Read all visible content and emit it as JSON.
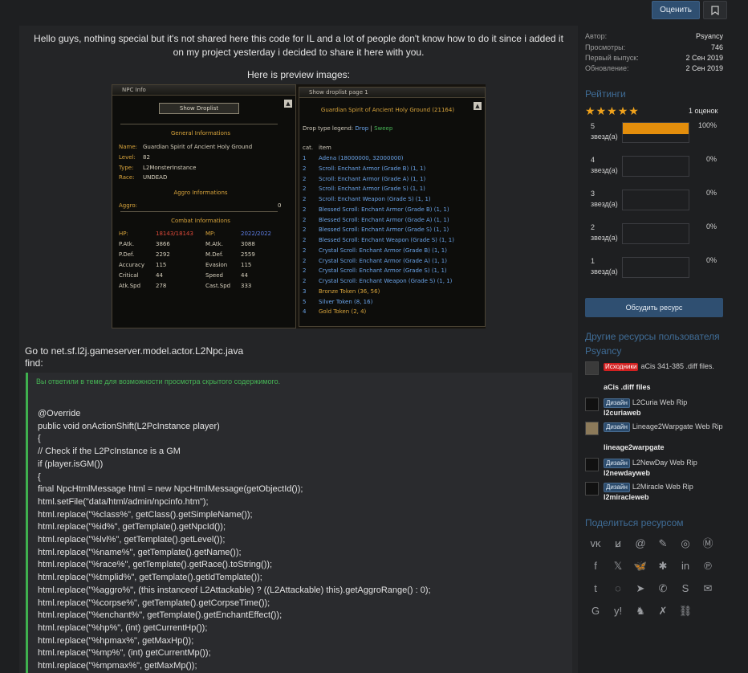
{
  "header": {
    "rate_label": "Оценить",
    "bookmark_icon": "bookmark-icon"
  },
  "post": {
    "intro": "Hello guys, nothing special but it's not shared here this code for IL and a lot of people don't know how to do it since i added it on my project yesterday i decided to share it here with you.",
    "preview_label": "Here is preview images:",
    "goto_line1": "Go to net.sf.l2j.gameserver.model.actor.L2Npc.java",
    "goto_line2": "find:",
    "hidden_message": "Вы ответили в теме для возможности просмотра скрытого содержимого.",
    "code": "@Override\npublic void onActionShift(L2PcInstance player)\n{\n// Check if the L2PcInstance is a GM\nif (player.isGM())\n{\nfinal NpcHtmlMessage html = new NpcHtmlMessage(getObjectId());\nhtml.setFile(\"data/html/admin/npcinfo.htm\");\nhtml.replace(\"%class%\", getClass().getSimpleName());\nhtml.replace(\"%id%\", getTemplate().getNpcId());\nhtml.replace(\"%lvl%\", getTemplate().getLevel());\nhtml.replace(\"%name%\", getTemplate().getName());\nhtml.replace(\"%race%\", getTemplate().getRace().toString());\nhtml.replace(\"%tmplid%\", getTemplate().getIdTemplate());\nhtml.replace(\"%aggro%\", (this instanceof L2Attackable) ? ((L2Attackable) this).getAggroRange() : 0);\nhtml.replace(\"%corpse%\", getTemplate().getCorpseTime());\nhtml.replace(\"%enchant%\", getTemplate().getEnchantEffect());\nhtml.replace(\"%hp%\", (int) getCurrentHp());\nhtml.replace(\"%hpmax%\", getMaxHp());\nhtml.replace(\"%mp%\", (int) getCurrentMp());\nhtml.replace(\"%mpmax%\", getMaxMp());"
  },
  "npc_info": {
    "title": "NPC Info",
    "show_droplist": "Show Droplist",
    "general_header": "General Informations",
    "name_label": "Name:",
    "name_value": "Guardian Spirit of Ancient Holy Ground",
    "level_label": "Level:",
    "level_value": "82",
    "type_label": "Type:",
    "type_value": "L2MonsterInstance",
    "race_label": "Race:",
    "race_value": "UNDEAD",
    "aggro_header": "Aggro Informations",
    "aggro_label": "Aggro:",
    "aggro_value": "0",
    "combat_header": "Combat Informations",
    "hp_label": "HP:",
    "hp_value": "18143/18143",
    "mp_label": "MP:",
    "mp_value": "2022/2022",
    "patk_label": "P.Atk.",
    "patk_value": "3866",
    "matk_label": "M.Atk.",
    "matk_value": "3088",
    "pdef_label": "P.Def.",
    "pdef_value": "2292",
    "mdef_label": "M.Def.",
    "mdef_value": "2559",
    "acc_label": "Accuracy",
    "acc_value": "115",
    "eva_label": "Evasion",
    "eva_value": "115",
    "crit_label": "Critical",
    "crit_value": "44",
    "spd_label": "Speed",
    "spd_value": "44",
    "aspd_label": "Atk.Spd",
    "aspd_value": "278",
    "cspd_label": "Cast.Spd",
    "cspd_value": "333"
  },
  "droplist": {
    "title": "Show droplist page 1",
    "mob": "Guardian Spirit of Ancient Holy Ground (21164)",
    "legend_label": "Drop type legend:",
    "legend_drop": "Drop",
    "legend_sweep": "Sweep",
    "col_cat": "cat.",
    "col_item": "item",
    "rows": [
      {
        "cat": "1",
        "item": "Adena (18000000, 32000000)"
      },
      {
        "cat": "2",
        "item": "Scroll: Enchant Armor (Grade B) (1, 1)"
      },
      {
        "cat": "2",
        "item": "Scroll: Enchant Armor (Grade A) (1, 1)"
      },
      {
        "cat": "2",
        "item": "Scroll: Enchant Armor (Grade S) (1, 1)"
      },
      {
        "cat": "2",
        "item": "Scroll: Enchant Weapon (Grade S) (1, 1)"
      },
      {
        "cat": "2",
        "item": "Blessed Scroll: Enchant Armor (Grade B) (1, 1)"
      },
      {
        "cat": "2",
        "item": "Blessed Scroll: Enchant Armor (Grade A) (1, 1)"
      },
      {
        "cat": "2",
        "item": "Blessed Scroll: Enchant Armor (Grade S) (1, 1)"
      },
      {
        "cat": "2",
        "item": "Blessed Scroll: Enchant Weapon (Grade S) (1, 1)"
      },
      {
        "cat": "2",
        "item": "Crystal Scroll: Enchant Armor (Grade B) (1, 1)"
      },
      {
        "cat": "2",
        "item": "Crystal Scroll: Enchant Armor (Grade A) (1, 1)"
      },
      {
        "cat": "2",
        "item": "Crystal Scroll: Enchant Armor (Grade S) (1, 1)"
      },
      {
        "cat": "2",
        "item": "Crystal Scroll: Enchant Weapon (Grade S) (1, 1)"
      },
      {
        "cat": "3",
        "item": "Bronze Token (36, 56)"
      },
      {
        "cat": "5",
        "item": "Silver Token (8, 16)"
      },
      {
        "cat": "4",
        "item": "Gold Token (2, 4)"
      }
    ]
  },
  "sidebar": {
    "author_label": "Автор:",
    "author_value": "Psyancy",
    "views_label": "Просмотры:",
    "views_value": "746",
    "first_label": "Первый выпуск:",
    "first_value": "2 Сен 2019",
    "update_label": "Обновление:",
    "update_value": "2 Сен 2019",
    "ratings_title": "Рейтинги",
    "stars_value": 5,
    "ratings_count": "1 оценок",
    "ratings": [
      {
        "stars": "5",
        "unit": "звезд(а)",
        "pct": "100%",
        "fraction": 1.0
      },
      {
        "stars": "4",
        "unit": "звезд(а)",
        "pct": "0%",
        "fraction": 0
      },
      {
        "stars": "3",
        "unit": "звезд(а)",
        "pct": "0%",
        "fraction": 0
      },
      {
        "stars": "2",
        "unit": "звезд(а)",
        "pct": "0%",
        "fraction": 0
      },
      {
        "stars": "1",
        "unit": "звезд(а)",
        "pct": "0%",
        "fraction": 0
      }
    ],
    "discuss_label": "Обсудить ресурс",
    "other_title": "Другие ресурсы пользователя Psyancy",
    "resources": [
      {
        "tag": "Исходники",
        "tag_color": "#d22020",
        "title": "aCis 341-385 .diff files.",
        "user": "aCis .diff files"
      },
      {
        "tag": "Дизайн",
        "tag_color": "#2a4a6b",
        "title": "L2Curia Web Rip",
        "user": "l2curiaweb"
      },
      {
        "tag": "Дизайн",
        "tag_color": "#2a4a6b",
        "title": "Lineage2Warpgate Web Rip",
        "user": "lineage2warpgate"
      },
      {
        "tag": "Дизайн",
        "tag_color": "#2a4a6b",
        "title": "L2NewDay Web Rip",
        "user": "l2newdayweb"
      },
      {
        "tag": "Дизайн",
        "tag_color": "#2a4a6b",
        "title": "L2Miracle Web Rip",
        "user": "l2miracleweb"
      }
    ],
    "share_title": "Поделиться ресурсом",
    "share_icons": [
      "vk-icon",
      "odnoklassniki-icon",
      "mail-icon",
      "livejournal-icon",
      "weibo-icon",
      "mastodon-icon",
      "facebook-icon",
      "x-icon",
      "bluesky-icon",
      "tumblr-icon",
      "linkedin-icon",
      "pinterest-icon",
      "tumblr-t-icon",
      "whatsapp-icon",
      "telegram-icon",
      "viber-icon",
      "skype-icon",
      "email-icon",
      "google-icon",
      "yahoo-icon",
      "evernote-icon",
      "xing-icon",
      "link-icon"
    ]
  },
  "colors": {
    "accent": "#2f4f71",
    "orange": "#e48e0c",
    "green": "#3fb04e",
    "link_blue": "#3f6c96"
  }
}
